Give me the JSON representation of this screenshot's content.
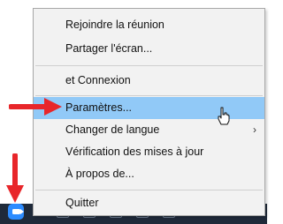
{
  "menu": {
    "items": [
      {
        "label": "Rejoindre la réunion"
      },
      {
        "label": "Partager l'écran..."
      },
      {
        "label": "et Connexion"
      },
      {
        "label": "Paramètres..."
      },
      {
        "label": "Changer de langue",
        "submenu_indicator": "›"
      },
      {
        "label": "Vérification des mises à jour"
      },
      {
        "label": "À propos de..."
      },
      {
        "label": "Quitter"
      }
    ],
    "highlighted_index": 3,
    "highlight_color": "#91c9f7"
  },
  "annotations": {
    "arrow_color": "#e8262a"
  },
  "taskbar": {
    "tray_icon": "zoom-app-icon",
    "tray_icon_color": "#2d8cff"
  }
}
